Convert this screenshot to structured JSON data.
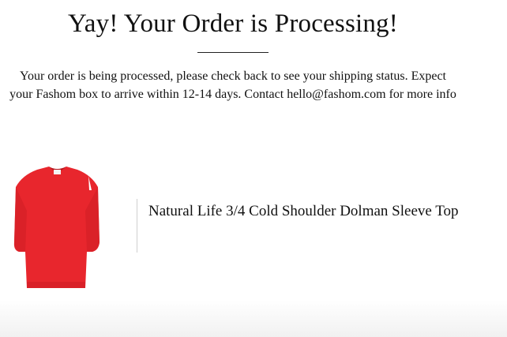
{
  "header": {
    "title": "Yay! Your Order is Processing!"
  },
  "message": {
    "line1": "Your order is being processed, please check back to see your shipping status. Expect",
    "line2": "your Fashom box to arrive within 12-14 days. Contact hello@fashom.com for more info"
  },
  "product": {
    "name": "Natural Life 3/4 Cold Shoulder Dolman Sleeve Top",
    "image_icon": "red-top-image",
    "color": "#e8262d"
  }
}
